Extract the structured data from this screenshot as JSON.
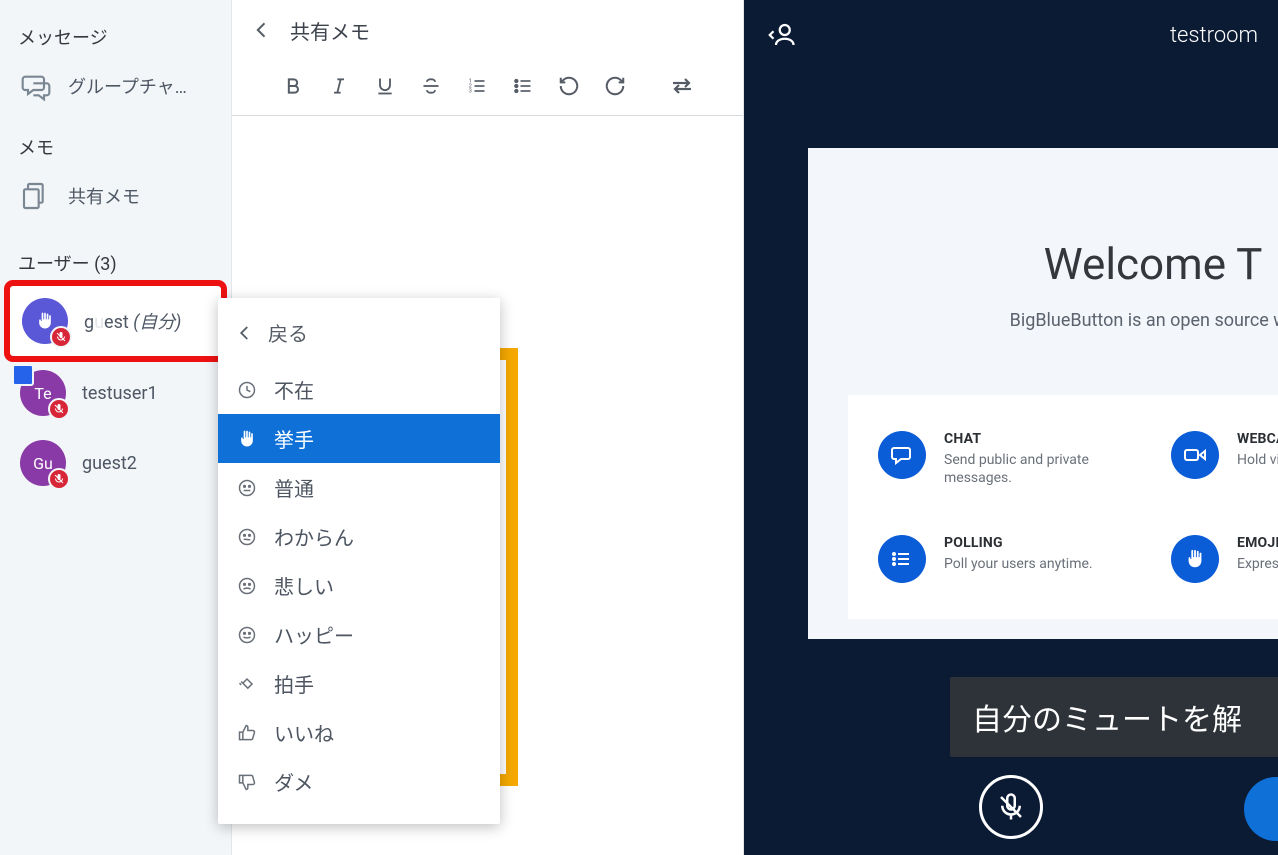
{
  "sidebar": {
    "messages_title": "メッセージ",
    "group_chat_label": "グループチャ…",
    "notes_title": "メモ",
    "shared_notes_label": "共有メモ",
    "users_title": "ユーザー",
    "user_count": "(3)",
    "users": [
      {
        "name_left": "g",
        "name_right": "est ",
        "self_label": "(自分)",
        "avatar_initials": "",
        "avatar_class": "blue",
        "muted": true,
        "raised": true,
        "selected": true,
        "highlight": true
      },
      {
        "name": "testuser1",
        "avatar_initials": "Te",
        "avatar_class": "purple",
        "muted": true,
        "square_badge": true
      },
      {
        "name": "guest2",
        "avatar_initials": "Gu",
        "avatar_class": "purple",
        "muted": true
      }
    ]
  },
  "middle": {
    "title": "共有メモ"
  },
  "status_menu": {
    "back_label": "戻る",
    "items": [
      {
        "label": "不在",
        "icon": "clock"
      },
      {
        "label": "挙手",
        "icon": "hand",
        "selected": true
      },
      {
        "label": "普通",
        "icon": "neutral"
      },
      {
        "label": "わからん",
        "icon": "confused"
      },
      {
        "label": "悲しい",
        "icon": "sad"
      },
      {
        "label": "ハッピー",
        "icon": "happy"
      },
      {
        "label": "拍手",
        "icon": "clap"
      },
      {
        "label": "いいね",
        "icon": "thumbsup"
      },
      {
        "label": "ダメ",
        "icon": "thumbsdown"
      }
    ]
  },
  "main": {
    "room_name": "testroom",
    "welcome_title": "Welcome T",
    "welcome_sub": "BigBlueButton is an open source we",
    "features": [
      {
        "title": "CHAT",
        "desc": "Send public and private messages.",
        "icon": "chat"
      },
      {
        "title": "WEBCAMS",
        "desc": "Hold visual meetin",
        "icon": "webcam"
      },
      {
        "title": "POLLING",
        "desc": "Poll your users anytime.",
        "icon": "poll"
      },
      {
        "title": "EMOJIS",
        "desc": "Express yourself.",
        "icon": "hand"
      }
    ],
    "toast": "自分のミュートを解"
  },
  "colors": {
    "accent": "#0f70d7",
    "danger": "#d72638",
    "highlight": "#f5a800",
    "highlight_red": "#e11"
  }
}
